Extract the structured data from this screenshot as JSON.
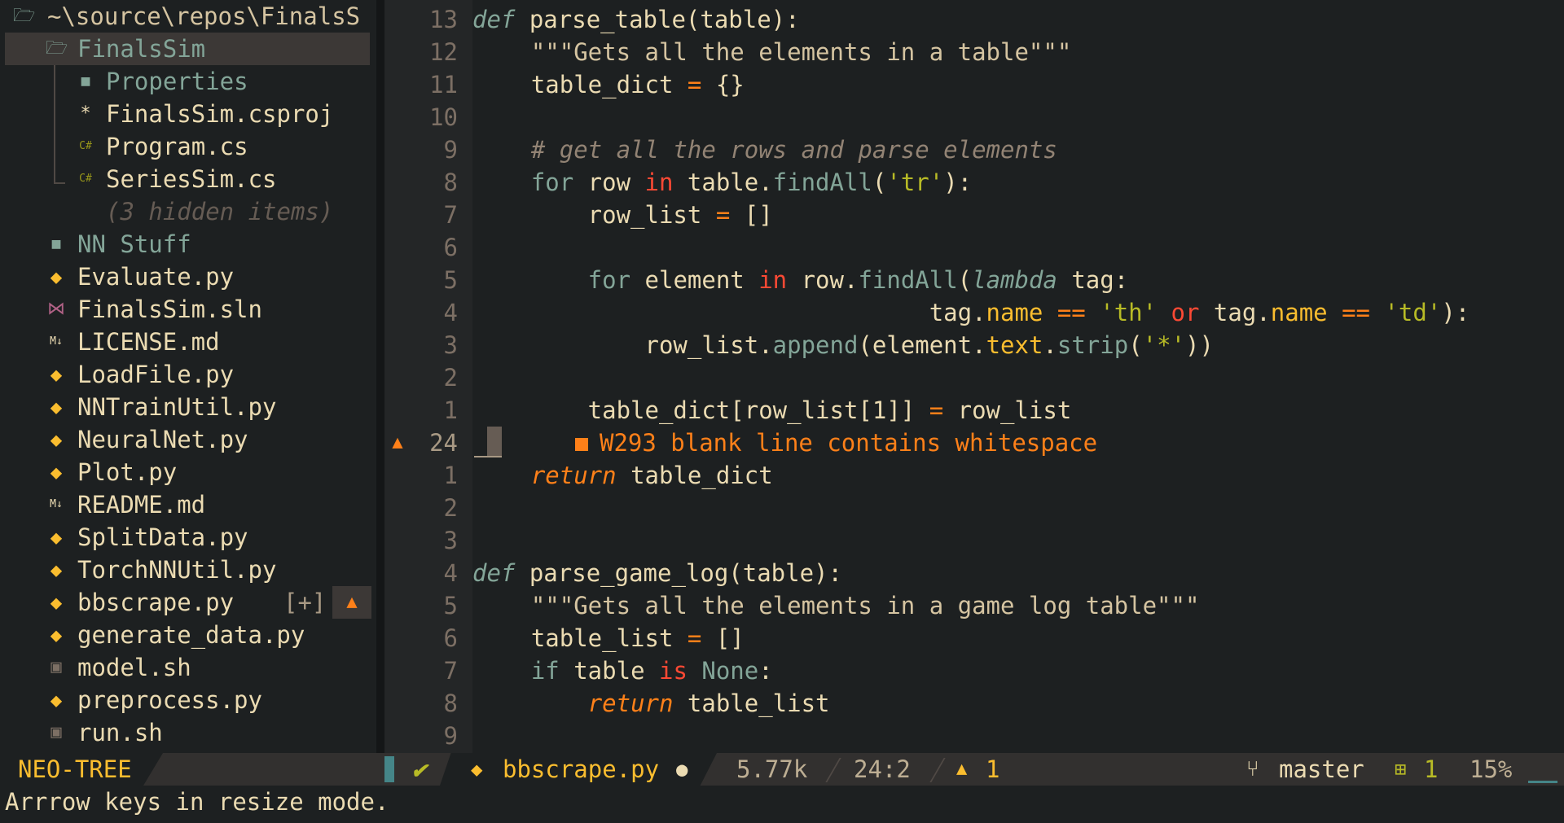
{
  "sidebar": {
    "root_path": "~\\source\\repos\\FinalsS",
    "items": [
      {
        "label": "FinalsSim",
        "kind": "dir-open",
        "icon": "folder-open-icon"
      },
      {
        "label": "Properties",
        "kind": "dir",
        "icon": "folder-icon"
      },
      {
        "label": "FinalsSim.csproj",
        "kind": "file",
        "icon": "asterisk-icon"
      },
      {
        "label": "Program.cs",
        "kind": "file",
        "icon": "csharp-icon"
      },
      {
        "label": "SeriesSim.cs",
        "kind": "file",
        "icon": "csharp-icon"
      },
      {
        "label": "(3 hidden items)",
        "kind": "hidden"
      },
      {
        "label": "NN Stuff",
        "kind": "dir",
        "icon": "folder-icon"
      },
      {
        "label": "Evaluate.py",
        "kind": "file",
        "icon": "python-icon"
      },
      {
        "label": "FinalsSim.sln",
        "kind": "file",
        "icon": "visual-studio-icon"
      },
      {
        "label": "LICENSE.md",
        "kind": "file",
        "icon": "markdown-icon"
      },
      {
        "label": "LoadFile.py",
        "kind": "file",
        "icon": "python-icon"
      },
      {
        "label": "NNTrainUtil.py",
        "kind": "file",
        "icon": "python-icon"
      },
      {
        "label": "NeuralNet.py",
        "kind": "file",
        "icon": "python-icon"
      },
      {
        "label": "Plot.py",
        "kind": "file",
        "icon": "python-icon"
      },
      {
        "label": "README.md",
        "kind": "file",
        "icon": "markdown-icon"
      },
      {
        "label": "SplitData.py",
        "kind": "file",
        "icon": "python-icon"
      },
      {
        "label": "TorchNNUtil.py",
        "kind": "file",
        "icon": "python-icon"
      },
      {
        "label": "bbscrape.py",
        "kind": "file",
        "icon": "python-icon",
        "modified": "[+]"
      },
      {
        "label": "generate_data.py",
        "kind": "file",
        "icon": "python-icon"
      },
      {
        "label": "model.sh",
        "kind": "file",
        "icon": "terminal-icon"
      },
      {
        "label": "preprocess.py",
        "kind": "file",
        "icon": "python-icon"
      },
      {
        "label": "run.sh",
        "kind": "file",
        "icon": "terminal-icon"
      }
    ]
  },
  "editor": {
    "line_numbers": [
      "13",
      "12",
      "11",
      "10",
      "9",
      "8",
      "7",
      "6",
      "5",
      "4",
      "3",
      "2",
      "1",
      "24",
      "1",
      "2",
      "3",
      "4",
      "5",
      "6",
      "7",
      "8",
      "9"
    ],
    "diagnostic": "W293 blank line contains whitespace",
    "code": {
      "l0_def": "def",
      "l0_rest": " parse_table(table):",
      "l1": "    \"\"\"Gets all the elements in a table\"\"\"",
      "l2_var": "    table_dict ",
      "l2_op": "=",
      "l2_rest": " {}",
      "l4": "    # get all the rows and parse elements",
      "l5_for": "    for",
      "l5_row": " row ",
      "l5_in": "in",
      "l5_tbl": " table.",
      "l5_meth": "findAll",
      "l5_open": "(",
      "l5_str": "'tr'",
      "l5_close": "):",
      "l6_var": "        row_list ",
      "l6_op": "=",
      "l6_rest": " []",
      "l8_for": "        for",
      "l8_el": " element ",
      "l8_in": "in",
      "l8_row": " row.",
      "l8_meth": "findAll",
      "l8_open": "(",
      "l8_lambda": "lambda",
      "l8_tag": " tag:",
      "l9_tag": "                                tag.",
      "l9_name1": "name",
      "l9_eq1": " == ",
      "l9_th": "'th'",
      "l9_or": " or",
      "l9_tag2": " tag.",
      "l9_name2": "name",
      "l9_eq2": " == ",
      "l9_td": "'td'",
      "l9_close": "):",
      "l10_var": "            row_list.",
      "l10_append": "append",
      "l10_el": "(element.",
      "l10_text": "text",
      "l10_dot": ".",
      "l10_strip": "strip",
      "l10_open": "(",
      "l10_star": "'*'",
      "l10_close": "))",
      "l12_a": "        table_dict[row_list[1]] ",
      "l12_op": "=",
      "l12_b": " row_list",
      "l14_ret": "return",
      "l14_rest": " table_dict",
      "l17_def": "def",
      "l17_rest": " parse_game_log(table):",
      "l18": "    \"\"\"Gets all the elements in a game log table\"\"\"",
      "l19_var": "    table_list ",
      "l19_op": "=",
      "l19_rest": " []",
      "l20_if": "    if",
      "l20_tbl": " table ",
      "l20_is": "is",
      "l20_none": " None",
      "l20_colon": ":",
      "l21_ret": "return",
      "l21_rest": " table_list"
    }
  },
  "statusline": {
    "mode": "NEO-TREE",
    "filename": "bbscrape.py",
    "size": "5.77k",
    "position": "24:2",
    "warnings": "1",
    "branch": "master",
    "diff_added": "1",
    "percent": "15%"
  },
  "cmdline": "Arrrow keys in resize mode.",
  "colors": {
    "background": "#1d2021",
    "accent": "#fabd2f",
    "warning": "#fe8019",
    "keyword": "#fb4934"
  }
}
